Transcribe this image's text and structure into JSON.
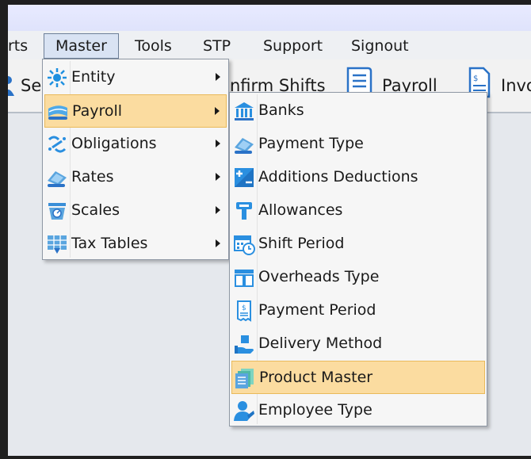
{
  "menubar": {
    "items": [
      "rts",
      "Master",
      "Tools",
      "STP",
      "Support",
      "Signout"
    ]
  },
  "toolbar": {
    "items": [
      "Se",
      "nfirm Shifts",
      "Payroll",
      "Invo"
    ]
  },
  "master_menu": {
    "items": [
      {
        "label": "Entity",
        "icon": "entity-icon"
      },
      {
        "label": "Payroll",
        "icon": "payroll-icon"
      },
      {
        "label": "Obligations",
        "icon": "obligations-icon"
      },
      {
        "label": "Rates",
        "icon": "rates-icon"
      },
      {
        "label": "Scales",
        "icon": "scales-icon"
      },
      {
        "label": "Tax Tables",
        "icon": "tax-tables-icon"
      }
    ]
  },
  "payroll_submenu": {
    "items": [
      {
        "label": "Banks",
        "icon": "bank-icon"
      },
      {
        "label": "Payment Type",
        "icon": "payment-type-icon"
      },
      {
        "label": "Additions  Deductions",
        "icon": "plus-minus-icon"
      },
      {
        "label": "Allowances",
        "icon": "allowances-icon"
      },
      {
        "label": "Shift Period",
        "icon": "calendar-clock-icon"
      },
      {
        "label": "Overheads Type",
        "icon": "overheads-icon"
      },
      {
        "label": "Payment Period",
        "icon": "payslip-icon"
      },
      {
        "label": "Delivery Method",
        "icon": "delivery-icon"
      },
      {
        "label": "Product Master",
        "icon": "product-master-icon"
      },
      {
        "label": "Employee Type",
        "icon": "employee-icon"
      }
    ]
  }
}
